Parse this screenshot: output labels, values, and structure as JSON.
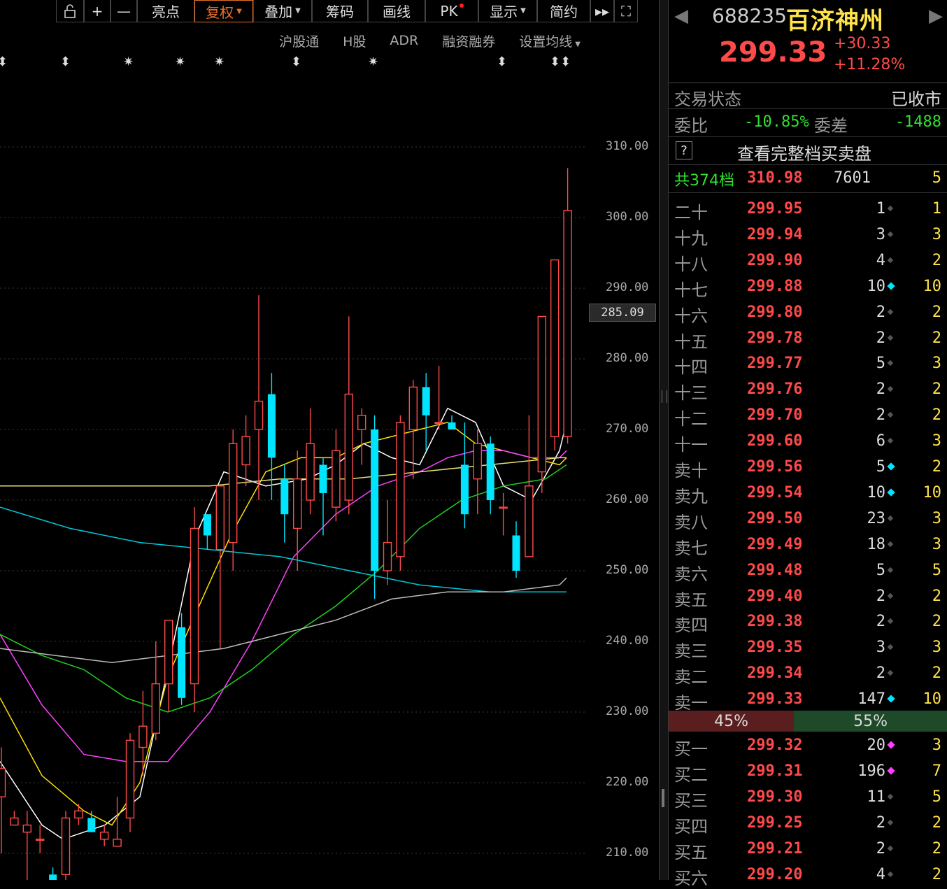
{
  "toolbar": {
    "items": [
      {
        "label": "",
        "icon": "lock-open-icon"
      },
      {
        "label": "+",
        "icon": "zoom-in-icon"
      },
      {
        "label": "—",
        "icon": "zoom-out-icon"
      },
      {
        "label": "亮点"
      },
      {
        "label": "复权",
        "active": true,
        "caret": true
      },
      {
        "label": "叠加",
        "caret": true
      },
      {
        "label": "筹码"
      },
      {
        "label": "画线"
      },
      {
        "label": "PK",
        "dot": true
      },
      {
        "label": "显示",
        "caret": true
      },
      {
        "label": "简约"
      },
      {
        "label": "▸▸",
        "icon": "fast-forward-icon"
      },
      {
        "label": "⛶",
        "icon": "fullscreen-icon"
      }
    ]
  },
  "subbar": {
    "items": [
      "沪股通",
      "H股",
      "ADR",
      "融资融券",
      "设置均线"
    ]
  },
  "markers": [
    "⬍",
    "⬍",
    "✷",
    "✷",
    "✷",
    "⬍",
    "✷",
    "⬍",
    "⬍⬍"
  ],
  "y_axis": {
    "labels": [
      "310.00",
      "300.00",
      "290.00",
      "280.00",
      "270.00",
      "260.00",
      "250.00",
      "240.00",
      "230.00",
      "220.00",
      "210.00"
    ],
    "current": "285.09"
  },
  "chart_data": {
    "type": "candlestick",
    "ylim": [
      205,
      315
    ],
    "candles": [
      {
        "o": 218,
        "c": 222,
        "h": 225,
        "l": 210
      },
      {
        "o": 214,
        "c": 215,
        "h": 216,
        "l": 214
      },
      {
        "o": 213,
        "c": 214,
        "h": 216,
        "l": 206
      },
      {
        "o": 212,
        "c": 212,
        "h": 214,
        "l": 210
      },
      {
        "o": 207,
        "c": 205,
        "h": 208,
        "l": 202
      },
      {
        "o": 207,
        "c": 215,
        "h": 216,
        "l": 202
      },
      {
        "o": 215,
        "c": 216,
        "h": 217,
        "l": 214
      },
      {
        "o": 215,
        "c": 213,
        "h": 216,
        "l": 213
      },
      {
        "o": 212,
        "c": 213,
        "h": 214,
        "l": 211
      },
      {
        "o": 211,
        "c": 212,
        "h": 218,
        "l": 211
      },
      {
        "o": 215,
        "c": 226,
        "h": 227,
        "l": 213
      },
      {
        "o": 225,
        "c": 228,
        "h": 233,
        "l": 221
      },
      {
        "o": 227,
        "c": 234,
        "h": 240,
        "l": 226
      },
      {
        "o": 234,
        "c": 243,
        "h": 243,
        "l": 230
      },
      {
        "o": 242,
        "c": 232,
        "h": 244,
        "l": 231
      },
      {
        "o": 234,
        "c": 256,
        "h": 259,
        "l": 230
      },
      {
        "o": 258,
        "c": 255,
        "h": 258,
        "l": 253
      },
      {
        "o": 253,
        "c": 262,
        "h": 262,
        "l": 239
      },
      {
        "o": 254,
        "c": 268,
        "h": 270,
        "l": 250
      },
      {
        "o": 265,
        "c": 269,
        "h": 272,
        "l": 262
      },
      {
        "o": 270,
        "c": 274,
        "h": 289,
        "l": 260
      },
      {
        "o": 275,
        "c": 266,
        "h": 278,
        "l": 260
      },
      {
        "o": 263,
        "c": 258,
        "h": 265,
        "l": 254
      },
      {
        "o": 256,
        "c": 263,
        "h": 267,
        "l": 250
      },
      {
        "o": 260,
        "c": 268,
        "h": 273,
        "l": 258
      },
      {
        "o": 265,
        "c": 261,
        "h": 266,
        "l": 255
      },
      {
        "o": 259,
        "c": 267,
        "h": 270,
        "l": 257
      },
      {
        "o": 260,
        "c": 275,
        "h": 286,
        "l": 258
      },
      {
        "o": 270,
        "c": 272,
        "h": 273,
        "l": 265
      },
      {
        "o": 270,
        "c": 250,
        "h": 272,
        "l": 246
      },
      {
        "o": 250,
        "c": 254,
        "h": 260,
        "l": 248
      },
      {
        "o": 252,
        "c": 271,
        "h": 272,
        "l": 250
      },
      {
        "o": 270,
        "c": 276,
        "h": 277,
        "l": 263
      },
      {
        "o": 276,
        "c": 272,
        "h": 278,
        "l": 267
      },
      {
        "o": 271,
        "c": 271,
        "h": 279,
        "l": 270
      },
      {
        "o": 271,
        "c": 270,
        "h": 272,
        "l": 270
      },
      {
        "o": 265,
        "c": 258,
        "h": 271,
        "l": 256
      },
      {
        "o": 263,
        "c": 268,
        "h": 270,
        "l": 258
      },
      {
        "o": 268,
        "c": 260,
        "h": 269,
        "l": 258
      },
      {
        "o": 259,
        "c": 259,
        "h": 261,
        "l": 255
      },
      {
        "o": 255,
        "c": 250,
        "h": 257,
        "l": 249
      },
      {
        "o": 252,
        "c": 262,
        "h": 272,
        "l": 252
      },
      {
        "o": 264,
        "c": 286,
        "h": 286,
        "l": 261
      },
      {
        "o": 269,
        "c": 294,
        "h": 294,
        "l": 267
      },
      {
        "o": 269,
        "c": 301,
        "h": 307,
        "l": 268
      }
    ],
    "ma": [
      {
        "color": "#ffffff",
        "values": [
          [
            0,
            223
          ],
          [
            60,
            214
          ],
          [
            90,
            212
          ],
          [
            150,
            214
          ],
          [
            200,
            218
          ],
          [
            240,
            236
          ],
          [
            280,
            255
          ],
          [
            320,
            264
          ],
          [
            380,
            262
          ],
          [
            440,
            263
          ],
          [
            480,
            265
          ],
          [
            520,
            268
          ],
          [
            560,
            266
          ],
          [
            600,
            265
          ],
          [
            640,
            273
          ],
          [
            680,
            271
          ],
          [
            720,
            262
          ],
          [
            760,
            260
          ],
          [
            800,
            267
          ],
          [
            810,
            271
          ]
        ]
      },
      {
        "color": "#ffde00",
        "values": [
          [
            0,
            232
          ],
          [
            60,
            221
          ],
          [
            120,
            216
          ],
          [
            160,
            214
          ],
          [
            200,
            220
          ],
          [
            240,
            235
          ],
          [
            280,
            244
          ],
          [
            330,
            255
          ],
          [
            380,
            264
          ],
          [
            430,
            266
          ],
          [
            480,
            266
          ],
          [
            520,
            268
          ],
          [
            560,
            269
          ],
          [
            600,
            270
          ],
          [
            640,
            271
          ],
          [
            680,
            268
          ],
          [
            720,
            267
          ],
          [
            760,
            266
          ],
          [
            800,
            265
          ],
          [
            810,
            266
          ]
        ]
      },
      {
        "color": "#ff40ff",
        "values": [
          [
            0,
            241
          ],
          [
            60,
            231
          ],
          [
            120,
            224
          ],
          [
            180,
            223
          ],
          [
            240,
            223
          ],
          [
            300,
            230
          ],
          [
            360,
            240
          ],
          [
            420,
            252
          ],
          [
            480,
            258
          ],
          [
            540,
            262
          ],
          [
            600,
            264
          ],
          [
            640,
            266
          ],
          [
            680,
            267
          ],
          [
            720,
            267
          ],
          [
            760,
            266
          ],
          [
            800,
            266
          ],
          [
            810,
            267
          ]
        ]
      },
      {
        "color": "#20d020",
        "values": [
          [
            0,
            241
          ],
          [
            60,
            238
          ],
          [
            120,
            236
          ],
          [
            180,
            232
          ],
          [
            240,
            230
          ],
          [
            300,
            232
          ],
          [
            360,
            236
          ],
          [
            420,
            241
          ],
          [
            480,
            245
          ],
          [
            540,
            250
          ],
          [
            600,
            256
          ],
          [
            660,
            260
          ],
          [
            720,
            262
          ],
          [
            780,
            263
          ],
          [
            810,
            265
          ]
        ]
      },
      {
        "color": "#00c8d8",
        "values": [
          [
            0,
            259
          ],
          [
            100,
            256
          ],
          [
            200,
            254
          ],
          [
            300,
            253
          ],
          [
            400,
            252
          ],
          [
            500,
            250
          ],
          [
            600,
            248
          ],
          [
            700,
            247
          ],
          [
            800,
            247
          ],
          [
            810,
            247
          ]
        ]
      },
      {
        "color": "#e8e070",
        "values": [
          [
            0,
            262
          ],
          [
            100,
            262
          ],
          [
            200,
            262
          ],
          [
            300,
            262
          ],
          [
            400,
            263
          ],
          [
            500,
            263
          ],
          [
            600,
            264
          ],
          [
            700,
            265
          ],
          [
            800,
            266
          ],
          [
            810,
            266
          ]
        ]
      },
      {
        "color": "#bbbbbb",
        "values": [
          [
            0,
            239
          ],
          [
            80,
            238
          ],
          [
            160,
            237
          ],
          [
            240,
            238
          ],
          [
            320,
            239
          ],
          [
            400,
            241
          ],
          [
            480,
            243
          ],
          [
            560,
            246
          ],
          [
            640,
            247
          ],
          [
            720,
            247
          ],
          [
            800,
            248
          ],
          [
            810,
            249
          ]
        ]
      }
    ]
  },
  "header": {
    "code": "688235",
    "name": "百济神州",
    "price": "299.33",
    "change": "+30.33",
    "pct": "+11.28%"
  },
  "status": {
    "label": "交易状态",
    "value": "已收市"
  },
  "weibi": {
    "label": "委比",
    "value": "-10.85%",
    "label2": "委差",
    "value2": "-1488"
  },
  "full_book": {
    "icon": "?",
    "label": "查看完整档买卖盘"
  },
  "total": {
    "label": "共374档",
    "price": "310.98",
    "vol": "7601",
    "count": "5"
  },
  "asks": [
    {
      "n": "二十",
      "p": "299.95",
      "v": "1",
      "c": "1",
      "hl": false
    },
    {
      "n": "十九",
      "p": "299.94",
      "v": "3",
      "c": "3",
      "hl": false
    },
    {
      "n": "十八",
      "p": "299.90",
      "v": "4",
      "c": "2",
      "hl": false
    },
    {
      "n": "十七",
      "p": "299.88",
      "v": "10",
      "c": "10",
      "hl": true
    },
    {
      "n": "十六",
      "p": "299.80",
      "v": "2",
      "c": "2",
      "hl": false
    },
    {
      "n": "十五",
      "p": "299.78",
      "v": "2",
      "c": "2",
      "hl": false
    },
    {
      "n": "十四",
      "p": "299.77",
      "v": "5",
      "c": "3",
      "hl": false
    },
    {
      "n": "十三",
      "p": "299.76",
      "v": "2",
      "c": "2",
      "hl": false
    },
    {
      "n": "十二",
      "p": "299.70",
      "v": "2",
      "c": "2",
      "hl": false
    },
    {
      "n": "十一",
      "p": "299.60",
      "v": "6",
      "c": "3",
      "hl": false
    },
    {
      "n": "卖十",
      "p": "299.56",
      "v": "5",
      "c": "2",
      "hl": true
    },
    {
      "n": "卖九",
      "p": "299.54",
      "v": "10",
      "c": "10",
      "hl": true
    },
    {
      "n": "卖八",
      "p": "299.50",
      "v": "23",
      "c": "3",
      "hl": false
    },
    {
      "n": "卖七",
      "p": "299.49",
      "v": "18",
      "c": "3",
      "hl": false
    },
    {
      "n": "卖六",
      "p": "299.48",
      "v": "5",
      "c": "5",
      "hl": false
    },
    {
      "n": "卖五",
      "p": "299.40",
      "v": "2",
      "c": "2",
      "hl": false
    },
    {
      "n": "卖四",
      "p": "299.38",
      "v": "2",
      "c": "2",
      "hl": false
    },
    {
      "n": "卖三",
      "p": "299.35",
      "v": "3",
      "c": "3",
      "hl": false
    },
    {
      "n": "卖二",
      "p": "299.34",
      "v": "2",
      "c": "2",
      "hl": false
    },
    {
      "n": "卖一",
      "p": "299.33",
      "v": "147",
      "c": "10",
      "hl": true
    }
  ],
  "ratio": {
    "sell": "45%",
    "buy": "55%"
  },
  "bids": [
    {
      "n": "买一",
      "p": "299.32",
      "v": "20",
      "c": "3",
      "hl": true
    },
    {
      "n": "买二",
      "p": "299.31",
      "v": "196",
      "c": "7",
      "hl": true
    },
    {
      "n": "买三",
      "p": "299.30",
      "v": "11",
      "c": "5",
      "hl": false
    },
    {
      "n": "买四",
      "p": "299.25",
      "v": "2",
      "c": "2",
      "hl": false
    },
    {
      "n": "买五",
      "p": "299.21",
      "v": "2",
      "c": "2",
      "hl": false
    },
    {
      "n": "买六",
      "p": "299.20",
      "v": "4",
      "c": "2",
      "hl": false
    }
  ],
  "colors": {
    "up": "#ff4a4a",
    "down": "#00e5ff",
    "ask_hl": "#00e5ff",
    "bid_hl": "#ff40ff",
    "dim": "#555555"
  }
}
